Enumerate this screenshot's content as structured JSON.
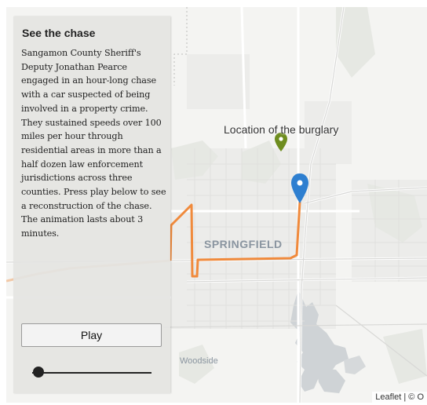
{
  "panel": {
    "title": "See the chase",
    "description": "Sangamon County Sheriff's Deputy Jonathan Pearce engaged in an hour-long chase with a car suspected of being involved in a property crime. They sustained speeds over 100 miles per hour through residential areas in more than a half dozen law enforcement jurisdictions across three counties. Press play below to see a reconstruction of the chase. The animation lasts about 3 minutes.",
    "play_label": "Play",
    "animation_progress": 0
  },
  "map": {
    "burglary_label": "Location of the burglary",
    "city_label": "SPRINGFIELD",
    "area_label": "Woodside",
    "attribution": "Leaflet | © O",
    "colors": {
      "route": "#f08a3c",
      "route_faded": "#f2c9a8",
      "water": "#cfd3d6",
      "green_pin": "#6e8d1f",
      "blue_pin": "#2e7fd0"
    }
  }
}
